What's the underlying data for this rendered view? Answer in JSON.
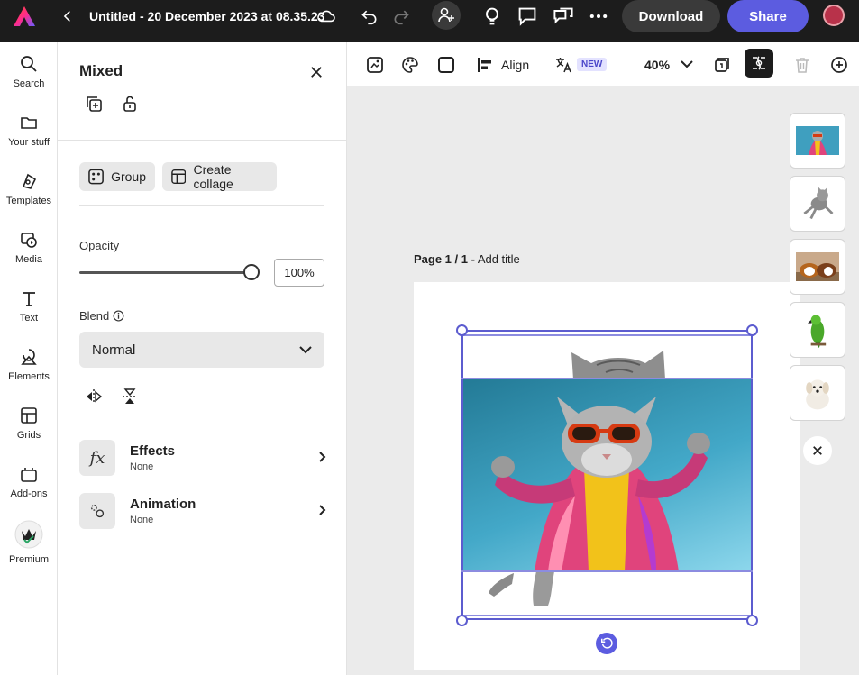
{
  "topbar": {
    "doc_title": "Untitled - 20 December 2023 at 08.35.23",
    "download_label": "Download",
    "share_label": "Share",
    "icons": [
      "adobe-express-logo",
      "back-chevron",
      "cloud",
      "undo",
      "redo",
      "invite-user",
      "lightbulb",
      "comment",
      "chat-bubbles",
      "more-dots"
    ]
  },
  "rail": {
    "items": [
      {
        "label": "Search",
        "icon": "search"
      },
      {
        "label": "Your stuff",
        "icon": "folder"
      },
      {
        "label": "Templates",
        "icon": "templates"
      },
      {
        "label": "Media",
        "icon": "media"
      },
      {
        "label": "Text",
        "icon": "text"
      },
      {
        "label": "Elements",
        "icon": "shapes"
      },
      {
        "label": "Grids",
        "icon": "grid"
      },
      {
        "label": "Add-ons",
        "icon": "addons"
      },
      {
        "label": "Premium",
        "icon": "crown"
      }
    ]
  },
  "panel": {
    "title": "Mixed",
    "group_label": "Group",
    "collage_label": "Create collage",
    "opacity_label": "Opacity",
    "opacity_value": "100%",
    "opacity_fraction": 1.0,
    "blend_label": "Blend",
    "blend_value": "Normal",
    "effects_title": "Effects",
    "effects_sub": "None",
    "animation_title": "Animation",
    "animation_sub": "None"
  },
  "toolbar": {
    "align_label": "Align",
    "new_badge": "NEW",
    "zoom_label": "40%"
  },
  "canvas": {
    "page_label_bold": "Page 1 / 1 -",
    "page_label_rest": " Add title"
  },
  "thumbs": [
    "cat-on-blue",
    "jumping-cat",
    "guinea-pigs",
    "green-parrot",
    "white-puppy"
  ],
  "colors": {
    "accent": "#5c5ce0",
    "topbar_bg": "#1c1c1c",
    "canvas_bg": "#ebebeb"
  }
}
